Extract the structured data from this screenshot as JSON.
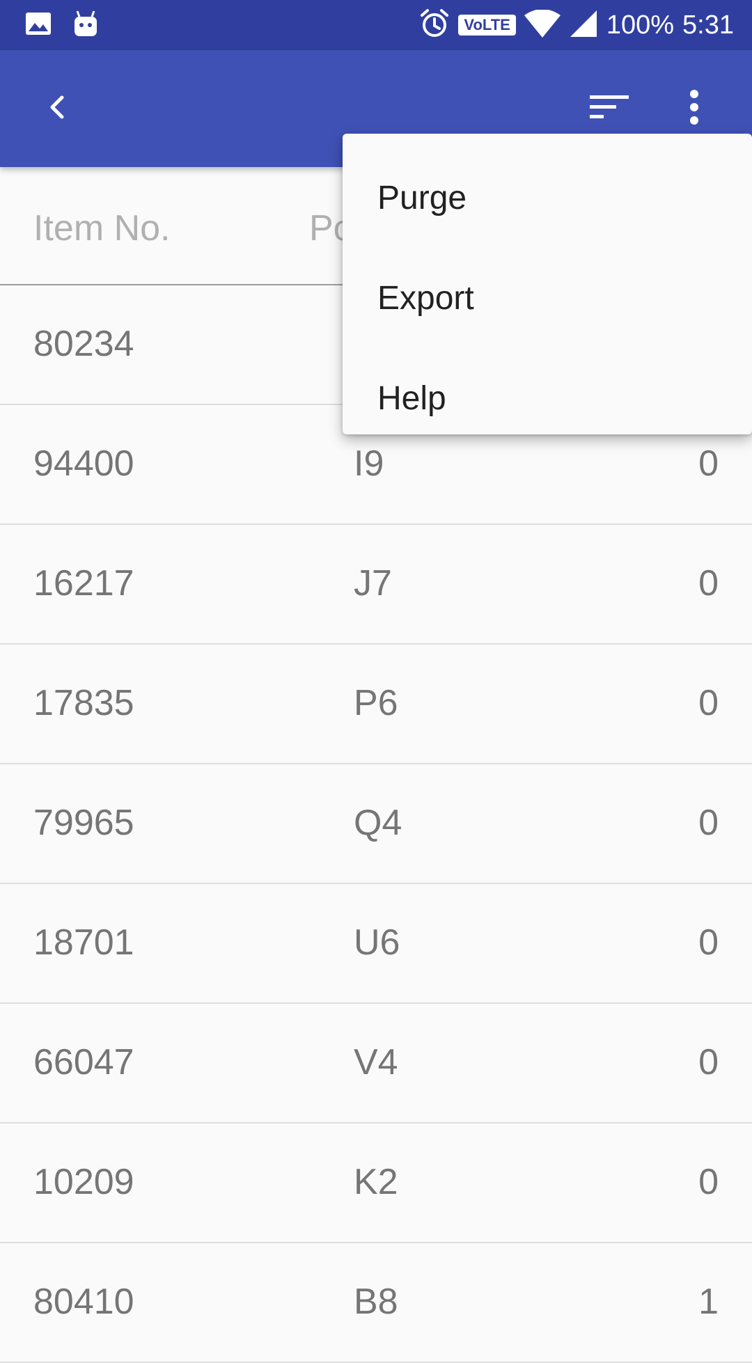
{
  "status_bar": {
    "battery": "100%",
    "time": "5:31",
    "volte": "VoLTE",
    "icons": [
      "image-icon",
      "android-debug-icon",
      "alarm-icon",
      "volte-icon",
      "wifi-icon",
      "signal-icon"
    ]
  },
  "toolbar": {
    "back_icon": "chevron-left-icon",
    "sort_icon": "sort-icon",
    "more_icon": "more-vert-icon"
  },
  "table": {
    "headers": {
      "item": "Item No.",
      "position": "Po"
    },
    "rows": [
      {
        "item": "80234",
        "position": "",
        "qty": ""
      },
      {
        "item": "94400",
        "position": "I9",
        "qty": "0"
      },
      {
        "item": "16217",
        "position": "J7",
        "qty": "0"
      },
      {
        "item": "17835",
        "position": "P6",
        "qty": "0"
      },
      {
        "item": "79965",
        "position": "Q4",
        "qty": "0"
      },
      {
        "item": "18701",
        "position": "U6",
        "qty": "0"
      },
      {
        "item": "66047",
        "position": "V4",
        "qty": "0"
      },
      {
        "item": "10209",
        "position": "K2",
        "qty": "0"
      },
      {
        "item": "80410",
        "position": "B8",
        "qty": "1"
      }
    ]
  },
  "menu": {
    "items": [
      {
        "label": "Purge"
      },
      {
        "label": "Export"
      },
      {
        "label": "Help"
      }
    ]
  },
  "colors": {
    "status_bar": "#303f9f",
    "toolbar": "#3f51b5",
    "background": "#fafafa"
  }
}
